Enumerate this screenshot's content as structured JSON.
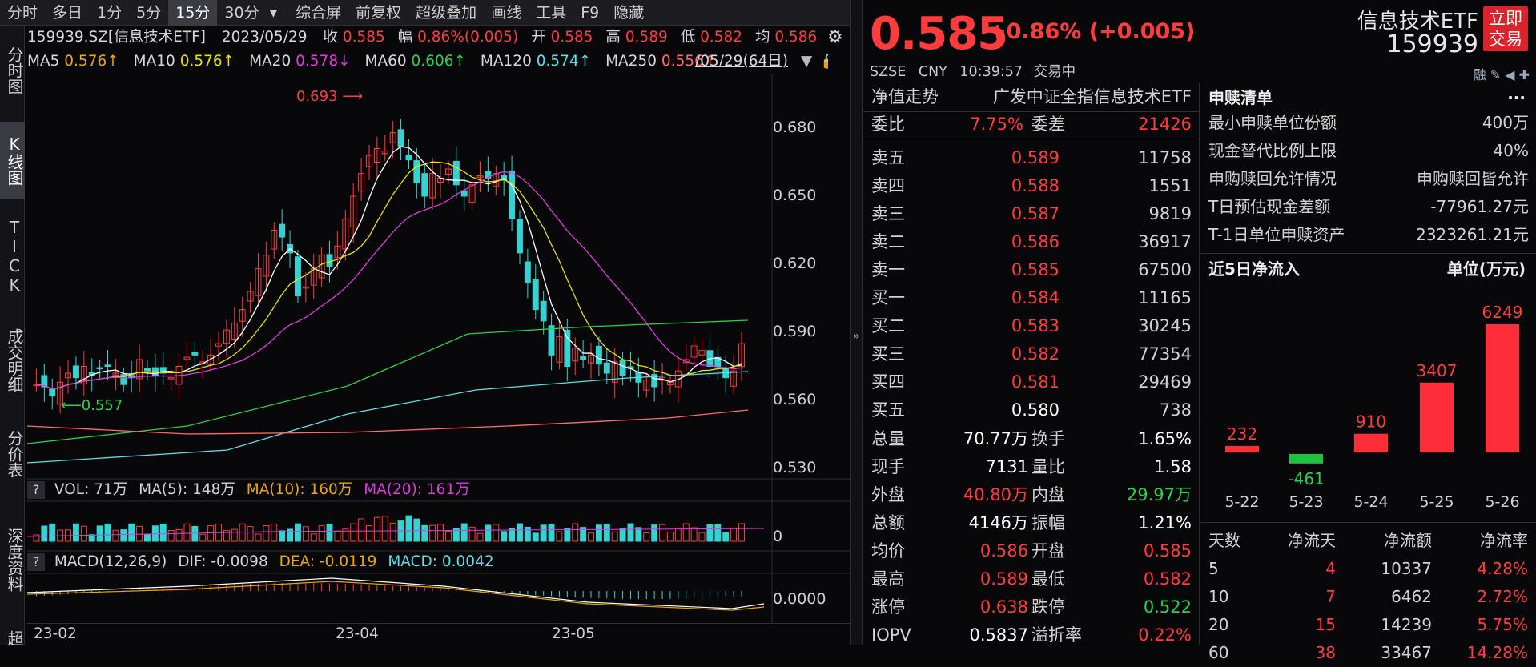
{
  "toolbar": {
    "tabs": [
      "分时",
      "多日",
      "1分",
      "5分",
      "15分",
      "30分",
      "▾",
      "综合屏",
      "前复权",
      "超级叠加",
      "画线",
      "工具",
      "F9",
      "隐藏"
    ],
    "active_index": 4
  },
  "leftnav": {
    "items": [
      "分时图",
      "K线图",
      "TICK",
      "成交明细",
      "分价表",
      "深度资料",
      "超"
    ],
    "active_index": 1
  },
  "info": {
    "code": "159939.SZ[信息技术ETF]",
    "date": "2023/05/29",
    "close_label": "收",
    "close": "0.585",
    "amp_label": "幅",
    "amp": "0.86%(0.005)",
    "open_label": "开",
    "open": "0.585",
    "high_label": "高",
    "high": "0.589",
    "low_label": "低",
    "low": "0.582",
    "avg_label": "均",
    "avg": "0.586"
  },
  "ma": {
    "ma5_label": "MA5",
    "ma5": "0.576↑",
    "ma10_label": "MA10",
    "ma10": "0.576↑",
    "ma20_label": "MA20",
    "ma20": "0.578↓",
    "ma60_label": "MA60",
    "ma60": "0.606↑",
    "ma120_label": "MA120",
    "ma120": "0.574↑",
    "ma250_label": "MA250",
    "ma250": "0.556↑",
    "range": "/05/29(64日)"
  },
  "chart": {
    "high_label": "0.693",
    "low_label": "0.557",
    "price_ticks": [
      "0.680",
      "0.650",
      "0.620",
      "0.590",
      "0.560",
      "0.530"
    ],
    "vol_tick": "0",
    "macd_tick": "0.0000",
    "x_ticks": [
      "23-02",
      "23-04",
      "23-05"
    ]
  },
  "volume": {
    "q": "?",
    "vol": "VOL: 71万",
    "ma5": "MA(5): 148万",
    "ma10": "MA(10): 160万",
    "ma20": "MA(20): 161万"
  },
  "macd": {
    "q": "?",
    "title": "MACD(12,26,9)",
    "dif": "DIF: -0.0098",
    "dea": "DEA: -0.0119",
    "macd": "MACD: 0.0042"
  },
  "header": {
    "price": "0.585",
    "change": "+0.86% (+0.005)",
    "exchange": "SZSE",
    "currency": "CNY",
    "time": "10:39:57",
    "status": "交易中",
    "name": "信息技术ETF",
    "code": "159939",
    "trade_btn": "立即交易",
    "icons": "融 ✎ ◀ ✚"
  },
  "quote": {
    "nav_label": "净值走势",
    "fund_name": "广发中证全指信息技术ETF",
    "wb_label": "委比",
    "wb": "7.75%",
    "wc_label": "委差",
    "wc": "21426",
    "asks": [
      {
        "label": "卖五",
        "price": "0.589",
        "vol": "11758"
      },
      {
        "label": "卖四",
        "price": "0.588",
        "vol": "1551"
      },
      {
        "label": "卖三",
        "price": "0.587",
        "vol": "9819"
      },
      {
        "label": "卖二",
        "price": "0.586",
        "vol": "36917"
      },
      {
        "label": "卖一",
        "price": "0.585",
        "vol": "67500"
      }
    ],
    "bids": [
      {
        "label": "买一",
        "price": "0.584",
        "vol": "11165"
      },
      {
        "label": "买二",
        "price": "0.583",
        "vol": "30245"
      },
      {
        "label": "买三",
        "price": "0.582",
        "vol": "77354"
      },
      {
        "label": "买四",
        "price": "0.581",
        "vol": "29469"
      },
      {
        "label": "买五",
        "price": "0.580",
        "vol": "738"
      }
    ],
    "stats": [
      {
        "l1": "总量",
        "v1": "70.77万",
        "l2": "换手",
        "v2": "1.65%"
      },
      {
        "l1": "现手",
        "v1": "7131",
        "l2": "量比",
        "v2": "1.58"
      },
      {
        "l1": "外盘",
        "v1": "40.80万",
        "l2": "内盘",
        "v2": "29.97万"
      },
      {
        "l1": "总额",
        "v1": "4146万",
        "l2": "振幅",
        "v2": "1.21%"
      },
      {
        "l1": "均价",
        "v1": "0.586",
        "l2": "开盘",
        "v2": "0.585"
      },
      {
        "l1": "最高",
        "v1": "0.589",
        "l2": "最低",
        "v2": "0.582"
      },
      {
        "l1": "涨停",
        "v1": "0.638",
        "l2": "跌停",
        "v2": "0.522"
      },
      {
        "l1": "IOPV",
        "v1": "0.5837",
        "l2": "溢折率",
        "v2": "0.22%"
      }
    ]
  },
  "redeem": {
    "title": "申赎清单",
    "more": "···",
    "rows": [
      {
        "l": "最小申赎单位份额",
        "r": "400万"
      },
      {
        "l": "现金替代比例上限",
        "r": "40%"
      },
      {
        "l": "申购赎回允许情况",
        "r": "申购赎回皆允许"
      },
      {
        "l": "T日预估现金差额",
        "r": "-77961.27元"
      },
      {
        "l": "T-1日单位申赎资产",
        "r": "2323261.21元"
      }
    ]
  },
  "flow": {
    "title": "近5日净流入",
    "unit": "单位(万元)"
  },
  "flow_table": {
    "headers": [
      "天数",
      "净流天",
      "净流额",
      "净流率"
    ],
    "rows": [
      [
        "5",
        "4",
        "10337",
        "4.28%"
      ],
      [
        "10",
        "7",
        "6462",
        "2.72%"
      ],
      [
        "20",
        "15",
        "14239",
        "5.75%"
      ],
      [
        "60",
        "38",
        "33467",
        "14.28%"
      ]
    ]
  },
  "chart_data": [
    {
      "type": "bar",
      "title": "近5日净流入",
      "ylabel": "单位(万元)",
      "categories": [
        "5-22",
        "5-23",
        "5-24",
        "5-25",
        "5-26"
      ],
      "values": [
        232,
        -461,
        910,
        3407,
        6249
      ],
      "colors": {
        "positive": "#ff2d3a",
        "negative": "#20c040"
      }
    }
  ],
  "colors": {
    "up": "#ff3b3b",
    "down": "#35d2d2",
    "ma5": "#ffffff",
    "ma10": "#e8e200",
    "ma20": "#e238e2",
    "ma60": "#2bd14a",
    "ma120": "#5ce0e8",
    "ma250": "#ff6b6b"
  }
}
